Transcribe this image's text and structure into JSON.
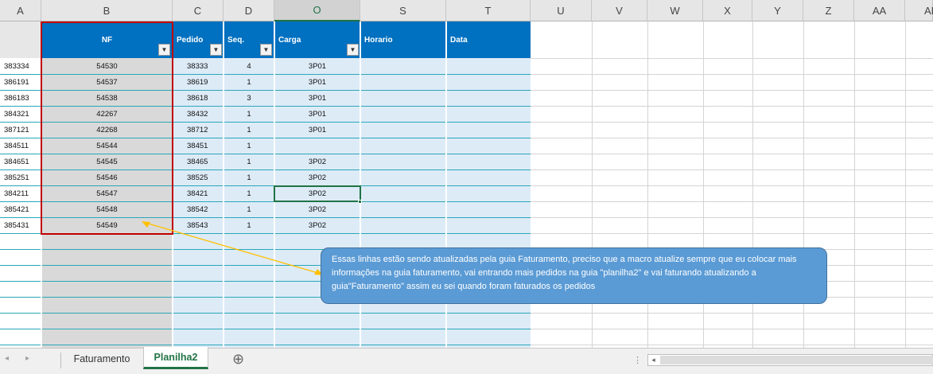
{
  "colors": {
    "table_header": "#0070c0",
    "row_band_light": "#ddebf7",
    "selection_green": "#217346",
    "nf_border": "#c00000",
    "callout_fill": "#5b9bd5",
    "arrow": "#ffc000"
  },
  "column_letters": [
    "A",
    "B",
    "C",
    "D",
    "O",
    "S",
    "T",
    "U",
    "V",
    "W",
    "X",
    "Y",
    "Z",
    "AA",
    "AB"
  ],
  "table": {
    "headers": {
      "nf": "NF",
      "pedido": "Pedido",
      "seq": "Seq.",
      "carga": "Carga",
      "horario": "Horario",
      "data": "Data"
    },
    "filter_icon": "dropdown-arrow-icon",
    "rows": [
      {
        "a": "383334",
        "nf": "54530",
        "pedido": "38333",
        "seq": "4",
        "carga": "3P01"
      },
      {
        "a": "386191",
        "nf": "54537",
        "pedido": "38619",
        "seq": "1",
        "carga": "3P01"
      },
      {
        "a": "386183",
        "nf": "54538",
        "pedido": "38618",
        "seq": "3",
        "carga": "3P01"
      },
      {
        "a": "384321",
        "nf": "42267",
        "pedido": "38432",
        "seq": "1",
        "carga": "3P01"
      },
      {
        "a": "387121",
        "nf": "42268",
        "pedido": "38712",
        "seq": "1",
        "carga": "3P01"
      },
      {
        "a": "384511",
        "nf": "54544",
        "pedido": "38451",
        "seq": "1",
        "carga": ""
      },
      {
        "a": "384651",
        "nf": "54545",
        "pedido": "38465",
        "seq": "1",
        "carga": "3P02"
      },
      {
        "a": "385251",
        "nf": "54546",
        "pedido": "38525",
        "seq": "1",
        "carga": "3P02"
      },
      {
        "a": "384211",
        "nf": "54547",
        "pedido": "38421",
        "seq": "1",
        "carga": "3P02"
      },
      {
        "a": "385421",
        "nf": "54548",
        "pedido": "38542",
        "seq": "1",
        "carga": "3P02"
      },
      {
        "a": "385431",
        "nf": "54549",
        "pedido": "38543",
        "seq": "1",
        "carga": "3P02"
      }
    ]
  },
  "callout": {
    "text": "Essas linhas estão sendo atualizadas pela guia Faturamento, preciso que a macro atualize sempre que eu colocar mais informações na guia faturamento, vai entrando mais pedidos na guia \"planilha2\" e vai faturando atualizando a guia\"Faturamento\" assim eu sei quando foram faturados os pedidos"
  },
  "sheet_tabs": {
    "tabs": [
      {
        "label": "Faturamento",
        "active": false
      },
      {
        "label": "Planilha2",
        "active": true
      }
    ],
    "prev_icon": "◂",
    "next_icon": "▸",
    "more_icon": "⋮",
    "add_icon": "⊕",
    "scroll_left_icon": "◂"
  }
}
